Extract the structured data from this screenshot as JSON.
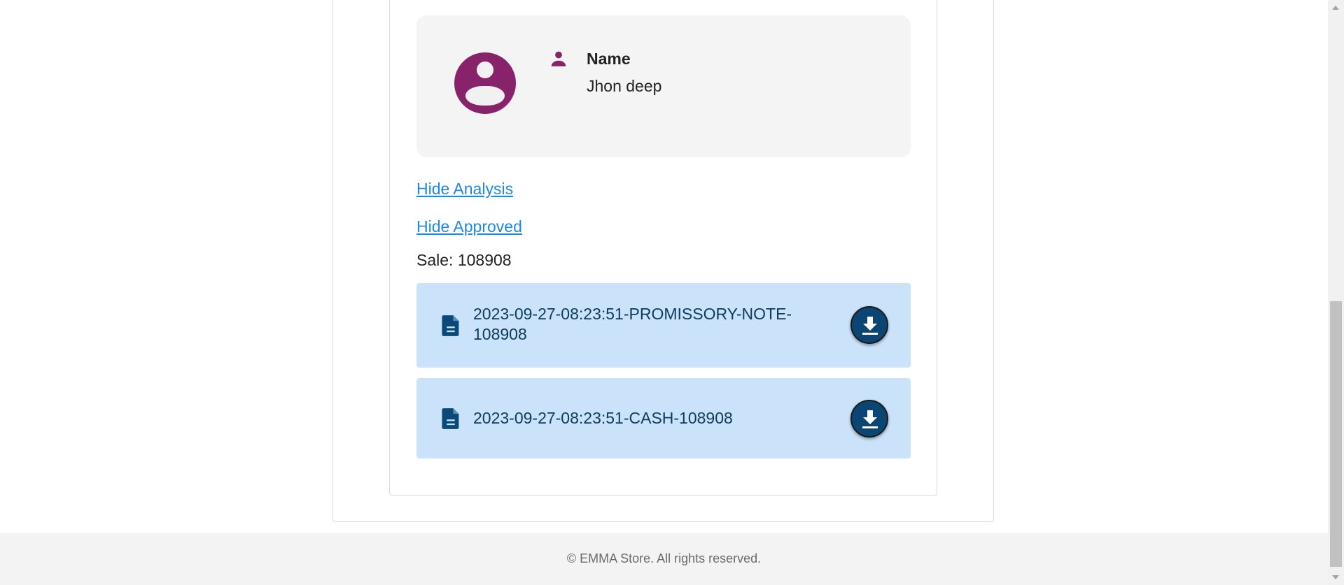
{
  "profile": {
    "name_label": "Name",
    "name_value": "Jhon deep",
    "avatar_icon": "account-circle-icon",
    "name_icon": "person-icon",
    "accent_color": "#88226b"
  },
  "links": {
    "hide_analysis": "Hide Analysis",
    "hide_approved": "Hide Approved"
  },
  "sale": {
    "label": "Sale: 108908"
  },
  "files": [
    {
      "name": "2023-09-27-08:23:51-PROMISSORY-NOTE-108908",
      "icon": "document-icon",
      "action_icon": "download-icon"
    },
    {
      "name": "2023-09-27-08:23:51-CASH-108908",
      "icon": "document-icon",
      "action_icon": "download-icon"
    }
  ],
  "footer": {
    "text": "© EMMA Store. All rights reserved."
  },
  "colors": {
    "link": "#1e88e5",
    "file_card_bg": "#cae3fb",
    "download_button": "#0b4573"
  }
}
